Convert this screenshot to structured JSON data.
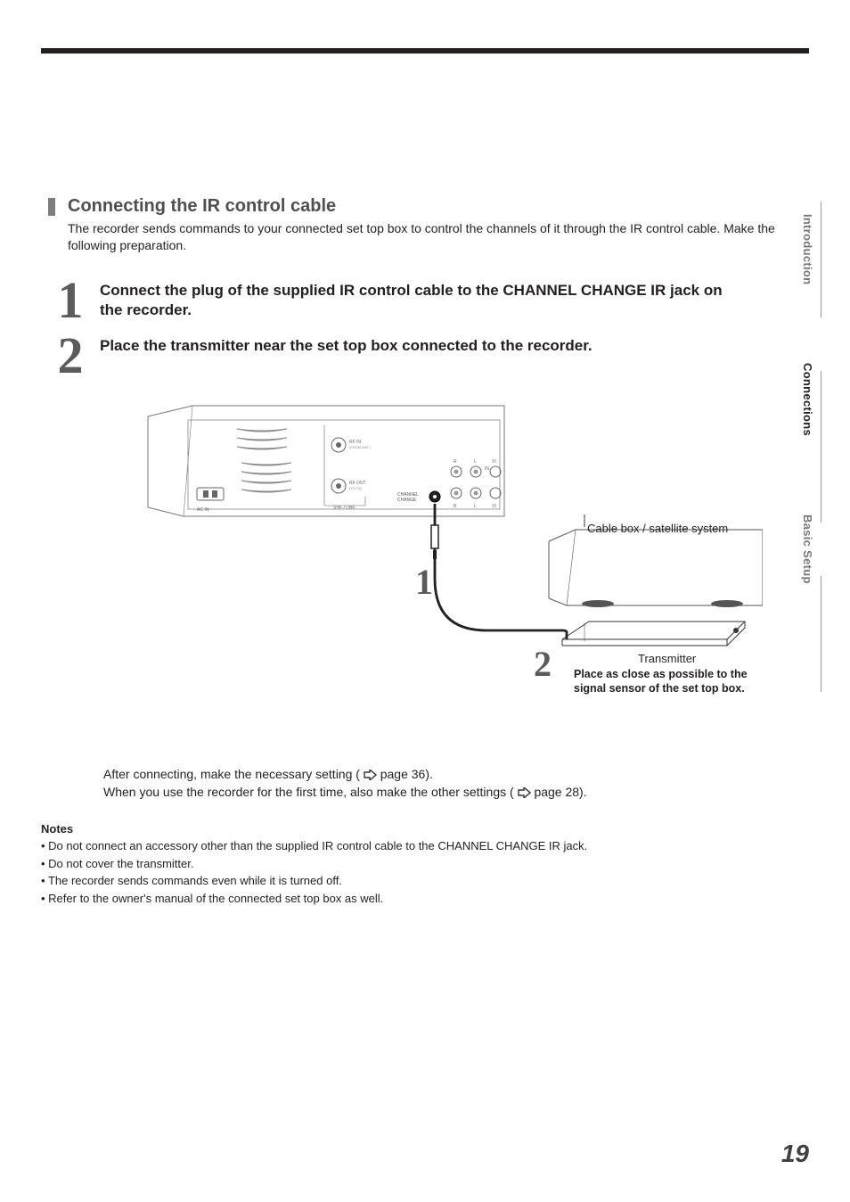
{
  "side_tabs": {
    "intro": "Introduction",
    "conn": "Connections",
    "setup": "Basic Setup"
  },
  "section": {
    "title": "Connecting the IR control cable",
    "desc": "The recorder sends commands to your connected set top box to control the channels of it through the IR control cable. Make the following preparation."
  },
  "steps": {
    "n1": "1",
    "t1": "Connect the plug of the supplied IR control cable to the CHANNEL CHANGE IR jack on the recorder.",
    "n2": "2",
    "t2": "Place the transmitter near the set top box connected to the recorder."
  },
  "diagram": {
    "cable_box": "Cable box / satellite system",
    "transmitter": "Transmitter",
    "place_close": "Place as close as possible to the signal sensor of the set top box.",
    "num1": "1",
    "num2": "2",
    "rf_in": "RF IN\n(FROM ANT.)",
    "rf_out": "RF OUT\n(TO TV)",
    "channel_change": "CHANNEL\nCHANGE",
    "vhf_uhf": "VHF / UHF",
    "ac_in": "AC IN",
    "in": "IN",
    "r": "R",
    "l": "L",
    "vi": "VI"
  },
  "after": {
    "line1a": "After connecting, make the necessary setting (",
    "line1b": " page 36).",
    "line2a": "When you use the recorder for the first time, also make the other settings (",
    "line2b": " page 28)."
  },
  "notes": {
    "head": "Notes",
    "n1": "Do not connect an accessory other than the supplied IR control cable to the CHANNEL CHANGE IR jack.",
    "n2": "Do not cover the transmitter.",
    "n3": "The recorder sends commands even while it is turned off.",
    "n4": "Refer to the owner's manual of the connected set top box as well."
  },
  "page_number": "19"
}
